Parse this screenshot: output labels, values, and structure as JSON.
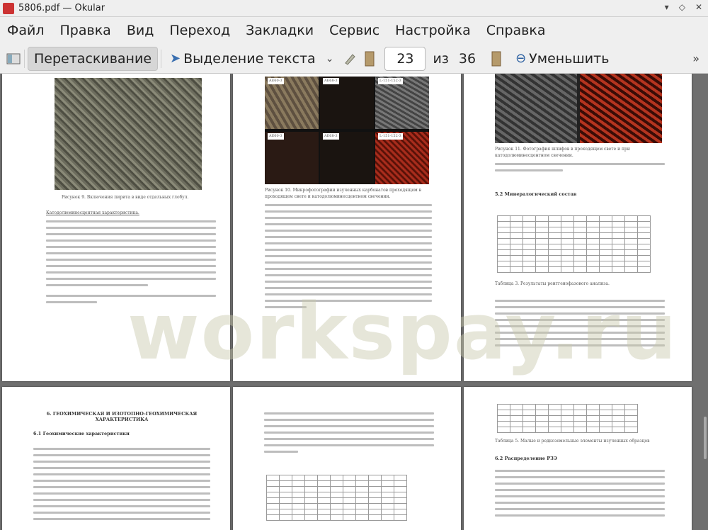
{
  "window": {
    "title": "5806.pdf — Okular"
  },
  "menu": [
    "Файл",
    "Правка",
    "Вид",
    "Переход",
    "Закладки",
    "Сервис",
    "Настройка",
    "Справка"
  ],
  "toolbar": {
    "drag_label": "Перетаскивание",
    "select_text_label": "Выделение текста",
    "page_current": "23",
    "page_of": "из",
    "page_total": "36",
    "zoom_out_label": "Уменьшить"
  },
  "pages": {
    "p1_caption": "Рисунок 9. Включения пирита в виде отдельных глобул.",
    "p1_heading": "Катодолюминесцентная характеристика.",
    "p2_caption": "Рисунок 10. Микрофотографии изученных карбонатов проходящем в проходящем свете и катодолюминесцентном свечении.",
    "p3_caption": "Рисунок 11. Фотография шлифов в проходящем свете и при катодолюминесцентном свечении.",
    "p3_section": "5.2 Минералогический состав",
    "p3_table_caption": "Таблица 3. Результаты рентгенофазового анализа.",
    "p4_heading": "6. ГЕОХИМИЧЕСКАЯ И ИЗОТОПНО-ГЕОХИМИЧЕСКАЯ ХАРАКТЕРИСТИКА",
    "p4_sub": "6.1 Геохимические характеристики",
    "p6_table_caption": "Таблица 5. Малые и редкоземельные элементы изученных образцов",
    "p6_section": "6.2 Распределение РЗЭ",
    "photo_labels": [
      "AE60-3",
      "AE68-3",
      "L-151-152-3",
      "AE60-3",
      "AE68-3",
      "L-151-152-3"
    ]
  },
  "watermark": "workspay.ru"
}
